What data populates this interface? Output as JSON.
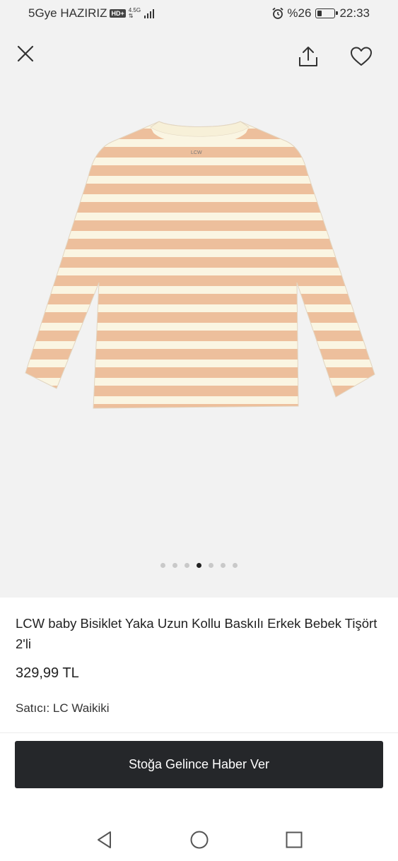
{
  "status_bar": {
    "carrier": "5Gye HAZIRIZ",
    "hd_badge": "HD+",
    "network": "4.5G",
    "battery": "%26",
    "battery_level": 0.26,
    "time": "22:33"
  },
  "header": {
    "close_icon": "close-icon",
    "share_icon": "share-icon",
    "favorite_icon": "heart-icon"
  },
  "gallery": {
    "image_count": 7,
    "active_index": 3,
    "label_on_shirt": "LCW"
  },
  "product": {
    "title": "LCW baby Bisiklet Yaka Uzun Kollu Baskılı Erkek Bebek Tişört 2'li",
    "price": "329,99 TL",
    "seller_label": "Satıcı:",
    "seller_name": "LC Waikiki"
  },
  "actions": {
    "notify_button": "Stoğa Gelince Haber Ver"
  },
  "colors": {
    "stripe": "#edbf9c",
    "base": "#faf5e2",
    "button_bg": "#25272a"
  }
}
